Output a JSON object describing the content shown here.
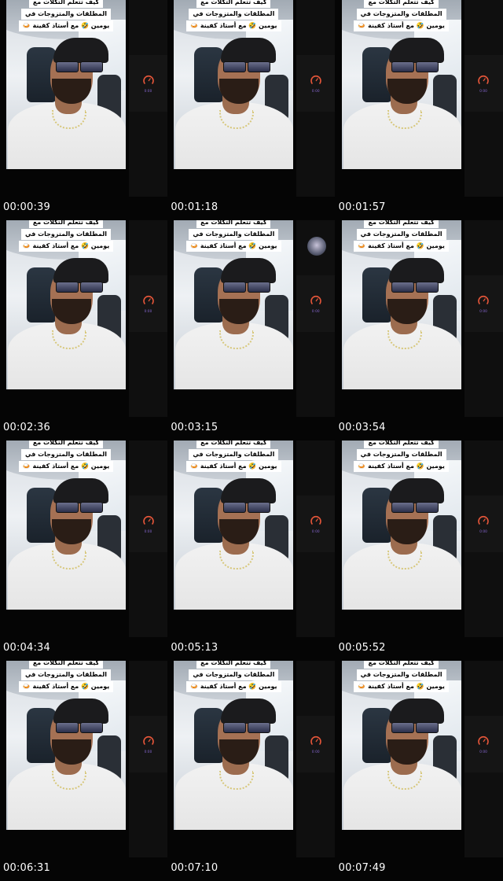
{
  "caption": {
    "line1": "كيف تتعلم التكلات مع",
    "line2": "المطلقات والمتزوجات في",
    "line3": "يومين 🤣 مع أستاذ كفينة 🍛"
  },
  "gauge_caption": "0:00",
  "accent_color": "#e8573a",
  "frames": [
    {
      "timestamp": "00:00:39"
    },
    {
      "timestamp": "00:01:18"
    },
    {
      "timestamp": "00:01:57"
    },
    {
      "timestamp": "00:02:36"
    },
    {
      "timestamp": "00:03:15"
    },
    {
      "timestamp": "00:03:54"
    },
    {
      "timestamp": "00:04:34"
    },
    {
      "timestamp": "00:05:13"
    },
    {
      "timestamp": "00:05:52"
    },
    {
      "timestamp": "00:06:31"
    },
    {
      "timestamp": "00:07:10"
    },
    {
      "timestamp": "00:07:49"
    }
  ]
}
